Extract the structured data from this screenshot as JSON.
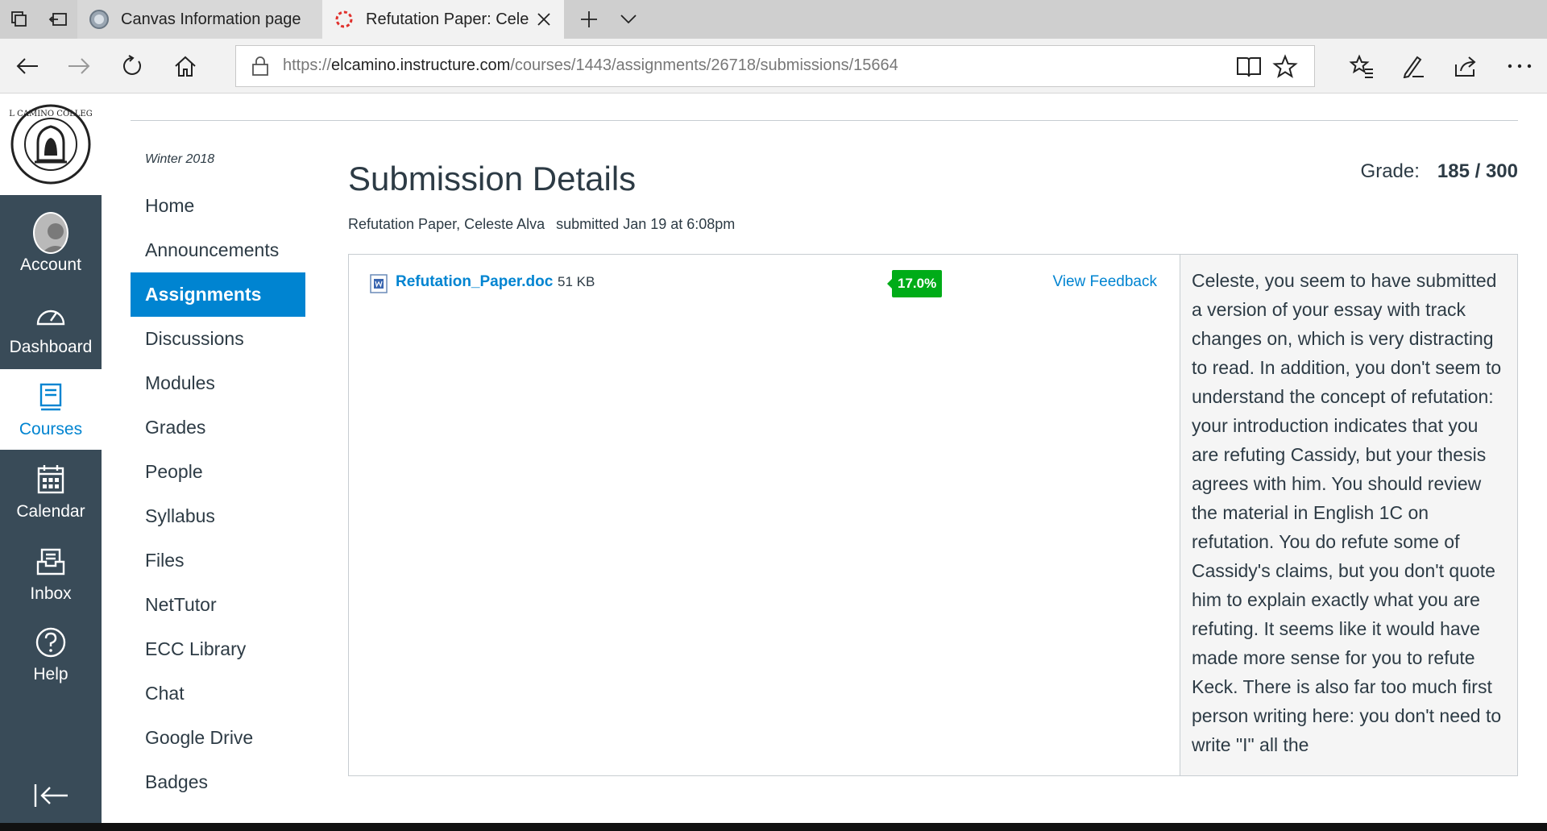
{
  "browser": {
    "tabs": [
      {
        "label": "Canvas Information page",
        "active": false
      },
      {
        "label": "Refutation Paper: Celes",
        "active": true
      }
    ],
    "url_prefix": "https://",
    "url_host": "elcamino.instructure.com",
    "url_path": "/courses/1443/assignments/26718/submissions/15664"
  },
  "global_nav": {
    "logo_text": "EL CAMINO COLLEGE",
    "items": [
      {
        "label": "Account",
        "icon": "avatar"
      },
      {
        "label": "Dashboard",
        "icon": "dashboard-icon"
      },
      {
        "label": "Courses",
        "icon": "courses-icon",
        "active": true
      },
      {
        "label": "Calendar",
        "icon": "calendar-icon"
      },
      {
        "label": "Inbox",
        "icon": "inbox-icon"
      },
      {
        "label": "Help",
        "icon": "help-icon"
      }
    ]
  },
  "course_nav": {
    "term": "Winter 2018",
    "items": [
      {
        "label": "Home"
      },
      {
        "label": "Announcements"
      },
      {
        "label": "Assignments",
        "active": true
      },
      {
        "label": "Discussions"
      },
      {
        "label": "Modules"
      },
      {
        "label": "Grades"
      },
      {
        "label": "People"
      },
      {
        "label": "Syllabus"
      },
      {
        "label": "Files"
      },
      {
        "label": "NetTutor"
      },
      {
        "label": "ECC Library"
      },
      {
        "label": "Chat"
      },
      {
        "label": "Google Drive"
      },
      {
        "label": "Badges"
      }
    ]
  },
  "main": {
    "title": "Submission Details",
    "grade_label": "Grade:",
    "grade_value": "185 / 300",
    "assignment_student": "Refutation Paper, Celeste Alva",
    "submitted": "submitted Jan 19 at 6:08pm",
    "file": {
      "name": "Refutation_Paper.doc",
      "size": "51 KB",
      "similarity": "17.0%",
      "view_feedback": "View Feedback"
    },
    "comment": "Celeste, you seem to have submitted a version of your essay with track changes on, which is very distracting to read. In addition, you don't seem to understand the concept of refutation: your introduction indicates that you are refuting Cassidy, but your thesis agrees with him. You should review the material in English 1C on refutation. You do refute some of Cassidy's claims, but you don't quote him to explain exactly what you are refuting. It seems like it would have made more sense for you to refute Keck. There is also far too much first person writing here: you don't need to write \"I\" all the"
  },
  "colors": {
    "nav_bg": "#394b58",
    "accent": "#0084d1",
    "badge_green": "#00ac18"
  }
}
